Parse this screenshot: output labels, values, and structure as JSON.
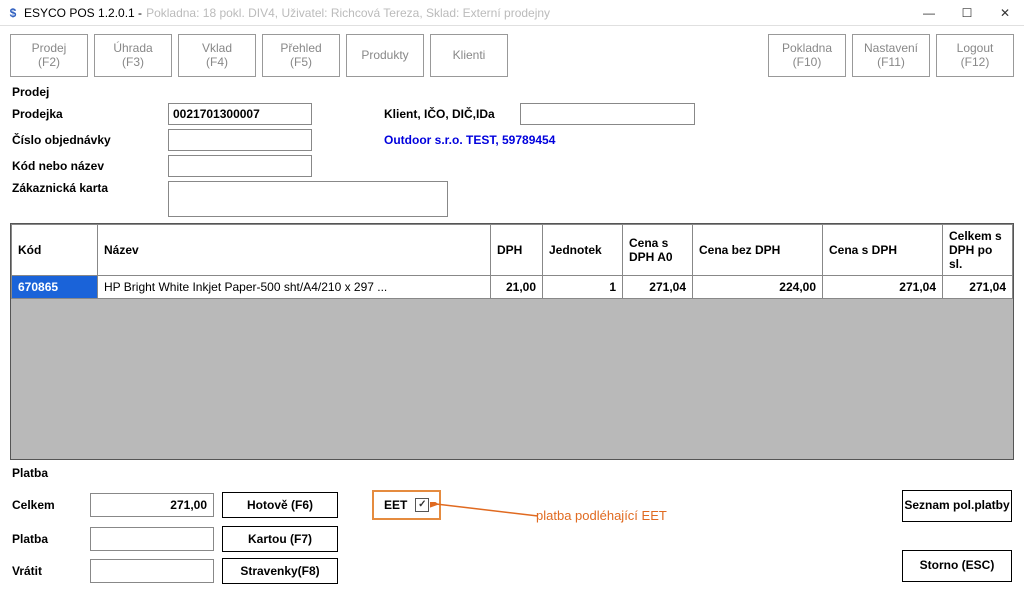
{
  "window": {
    "title_app": "ESYCO POS 1.2.0.1 -",
    "title_context": "Pokladna: 18   pokl. DIV4, Uživatel: Richcová Tereza, Sklad: Externí prodejny"
  },
  "toolbar": {
    "prodej": "Prodej\n(F2)",
    "uhrada": "Úhrada\n(F3)",
    "vklad": "Vklad\n(F4)",
    "prehled": "Přehled\n(F5)",
    "produkty": "Produkty",
    "klienti": "Klienti",
    "pokladna": "Pokladna\n(F10)",
    "nastaveni": "Nastavení\n(F11)",
    "logout": "Logout\n(F12)"
  },
  "sale": {
    "section": "Prodej",
    "labels": {
      "prodejka": "Prodejka",
      "objednavka": "Číslo objednávky",
      "kod": "Kód nebo název",
      "karta": "Zákaznická karta",
      "klient": "Klient, IČO, DIČ,IDa"
    },
    "prodejka_value": "0021701300007",
    "client_name": "Outdoor s.r.o. TEST, 59789454"
  },
  "grid": {
    "headers": {
      "kod": "Kód",
      "nazev": "Název",
      "dph": "DPH",
      "jednotek": "Jednotek",
      "cena_dph_a0": "Cena s DPH A0",
      "cena_bez_dph": "Cena bez DPH",
      "cena_s_dph": "Cena s DPH",
      "celkem": "Celkem s DPH po sl."
    },
    "rows": [
      {
        "kod": "670865",
        "nazev": "HP Bright White Inkjet Paper-500 sht/A4/210 x 297 ...",
        "dph": "21,00",
        "jednotek": "1",
        "cena_dph_a0": "271,04",
        "cena_bez_dph": "224,00",
        "cena_s_dph": "271,04",
        "celkem": "271,04"
      }
    ]
  },
  "payment": {
    "section": "Platba",
    "labels": {
      "celkem": "Celkem",
      "platba": "Platba",
      "vratit": "Vrátit"
    },
    "celkem": "271,00",
    "platba": "",
    "vratit": "",
    "buttons": {
      "hotove": "Hotově (F6)",
      "kartou": "Kartou (F7)",
      "stravenky": "Stravenky(F8)",
      "seznam": "Seznam pol.platby",
      "storno": "Storno (ESC)"
    },
    "eet_label": "EET",
    "eet_checked": "☑",
    "annotation": "platba podléhající EET"
  }
}
